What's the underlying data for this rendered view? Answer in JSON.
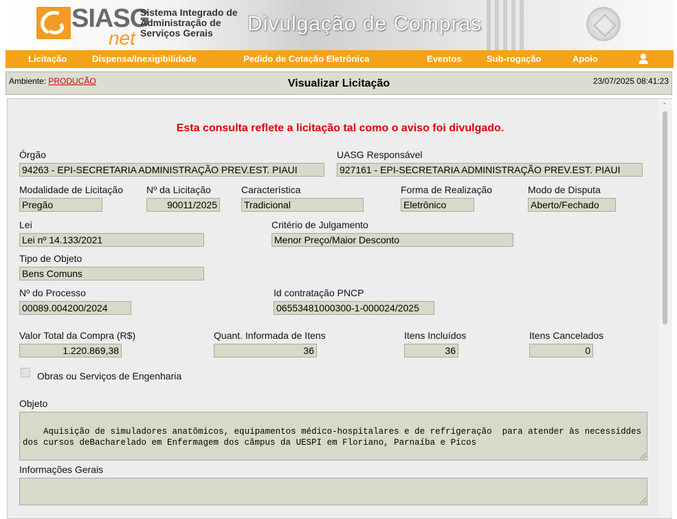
{
  "banner": {
    "logo_main": "SIASG",
    "logo_sub": "net",
    "system_name_1": "Sistema Integrado de",
    "system_name_2": "Administração de",
    "system_name_3": "Serviços Gerais",
    "headline": "Divulgação de Compras"
  },
  "menu": {
    "items": [
      "Licitação",
      "Dispensa/Inexigibilidade",
      "Pedido de Cotação Eletrônica",
      "Eventos",
      "Sub-rogação",
      "Apoio"
    ]
  },
  "titlebar": {
    "env_label": "Ambiente:",
    "env_value": "PRODUÇÃO",
    "title": "Visualizar Licitação",
    "datetime": "23/07/2025 08:41:23"
  },
  "notice": "Esta consulta reflete a licitação tal como o aviso foi divulgado.",
  "form": {
    "orgao": {
      "label": "Órgão",
      "value": "94263 - EPI-SECRETARIA ADMINISTRAÇÃO PREV.EST. PIAUI"
    },
    "uasg": {
      "label": "UASG Responsável",
      "value": "927161 - EPI-SECRETARIA ADMINISTRAÇÃO PREV.EST. PIAUI"
    },
    "modalidade": {
      "label": "Modalidade de Licitação",
      "value": "Pregão"
    },
    "numero": {
      "label": "Nº da Licitação",
      "value": "90011/2025"
    },
    "caracteristica": {
      "label": "Característica",
      "value": "Tradicional"
    },
    "forma": {
      "label": "Forma de Realização",
      "value": "Eletrônico"
    },
    "modo": {
      "label": "Modo de Disputa",
      "value": "Aberto/Fechado"
    },
    "lei": {
      "label": "Lei",
      "value": "Lei nº 14.133/2021"
    },
    "criterio": {
      "label": "Critério de Julgamento",
      "value": "Menor Preço/Maior Desconto"
    },
    "tipo_objeto": {
      "label": "Tipo de Objeto",
      "value": "Bens Comuns"
    },
    "processo": {
      "label": "Nº do Processo",
      "value": "00089.004200/2024"
    },
    "pncp": {
      "label": "Id contratação PNCP",
      "value": "06553481000300-1-000024/2025"
    },
    "valor_total": {
      "label": "Valor Total da Compra (R$)",
      "value": "1.220.869,38"
    },
    "quant_itens": {
      "label": "Quant. Informada de Itens",
      "value": "36"
    },
    "itens_incluidos": {
      "label": "Itens Incluídos",
      "value": "36"
    },
    "itens_cancelados": {
      "label": "Itens Cancelados",
      "value": "0"
    },
    "obras": {
      "label": "Obras ou Serviços de Engenharia",
      "checked": false
    },
    "objeto": {
      "label": "Objeto",
      "value": "Aquisição de simuladores anatômicos, equipamentos médico-hospitalares e de refrigeração  para atender às necessiddes dos cursos deBacharelado em Enfermagem dos câmpus da UESPI em Floriano, Parnaíba e Picos"
    },
    "info_gerais": {
      "label": "Informações Gerais",
      "value": ""
    }
  }
}
